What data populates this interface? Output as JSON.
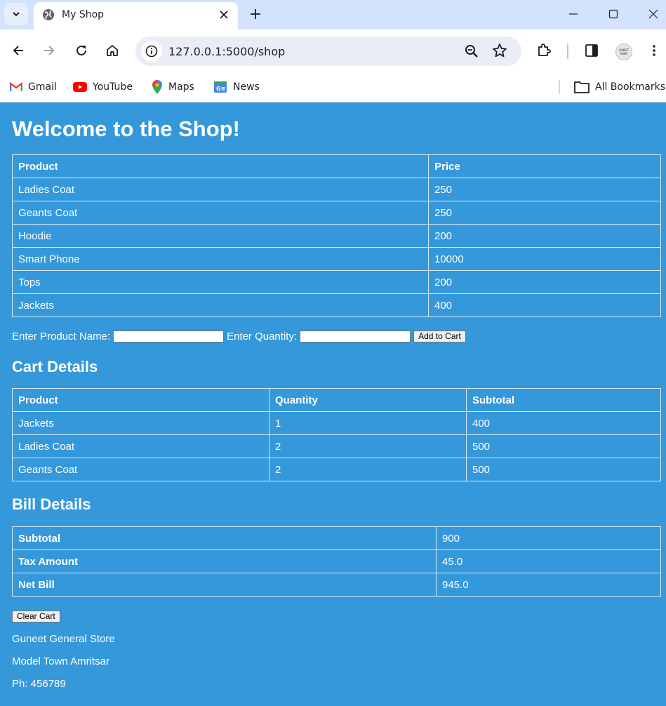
{
  "browser": {
    "tab_title": "My Shop",
    "url": "127.0.0.1:5000/shop",
    "avatar_text": "GUNEET KAUR",
    "bookmarks": [
      {
        "label": "Gmail",
        "icon": "gmail-icon"
      },
      {
        "label": "YouTube",
        "icon": "youtube-icon"
      },
      {
        "label": "Maps",
        "icon": "maps-icon"
      },
      {
        "label": "News",
        "icon": "news-icon"
      }
    ],
    "all_bookmarks": "All Bookmarks"
  },
  "page": {
    "heading": "Welcome to the Shop!",
    "products": {
      "headers": [
        "Product",
        "Price"
      ],
      "rows": [
        [
          "Ladies Coat",
          "250"
        ],
        [
          "Geants Coat",
          "250"
        ],
        [
          "Hoodie",
          "200"
        ],
        [
          "Smart Phone",
          "10000"
        ],
        [
          "Tops",
          "200"
        ],
        [
          "Jackets",
          "400"
        ]
      ]
    },
    "form": {
      "product_label": "Enter Product Name:",
      "product_value": "",
      "quantity_label": "Enter Quantity:",
      "quantity_value": "",
      "add_button": "Add to Cart"
    },
    "cart": {
      "heading": "Cart Details",
      "headers": [
        "Product",
        "Quantity",
        "Subtotal"
      ],
      "rows": [
        [
          "Jackets",
          "1",
          "400"
        ],
        [
          "Ladies Coat",
          "2",
          "500"
        ],
        [
          "Geants Coat",
          "2",
          "500"
        ]
      ]
    },
    "bill": {
      "heading": "Bill Details",
      "rows": [
        [
          "Subtotal",
          "900"
        ],
        [
          "Tax Amount",
          "45.0"
        ],
        [
          "Net Bill",
          "945.0"
        ]
      ]
    },
    "clear_button": "Clear Cart",
    "store": {
      "name": "Guneet General Store",
      "address": "Model Town Amritsar",
      "phone": "Ph: 456789"
    },
    "colors": {
      "background": "#3498db",
      "text": "#ffffff"
    }
  }
}
